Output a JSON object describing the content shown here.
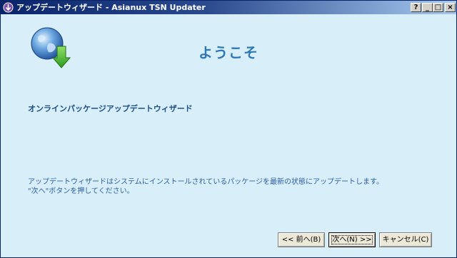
{
  "window": {
    "title": "アップデートウィザード - Asianux TSN Updater",
    "controls": {
      "help": "?",
      "minimize": "_",
      "maximize": "□",
      "close": "×"
    }
  },
  "icons": {
    "app": "app-icon",
    "hero": "globe-download-icon"
  },
  "main": {
    "heading": "ようこそ",
    "subtitle": "オンラインパッケージアップデートウィザード",
    "description_line1": "アップデートウィザードはシステムにインストールされているパッケージを最新の状態にアップデートします。",
    "description_line2": "\"次へ\"ボタンを押してください。"
  },
  "buttons": {
    "back": "<< 前へ(B)",
    "next": "次へ(N) >>",
    "cancel": "キャンセル(C)"
  },
  "colors": {
    "background": "#d8eef9",
    "heading": "#2f78b4",
    "subtitle": "#1c4f86",
    "titlebar_start": "#0a246a"
  }
}
